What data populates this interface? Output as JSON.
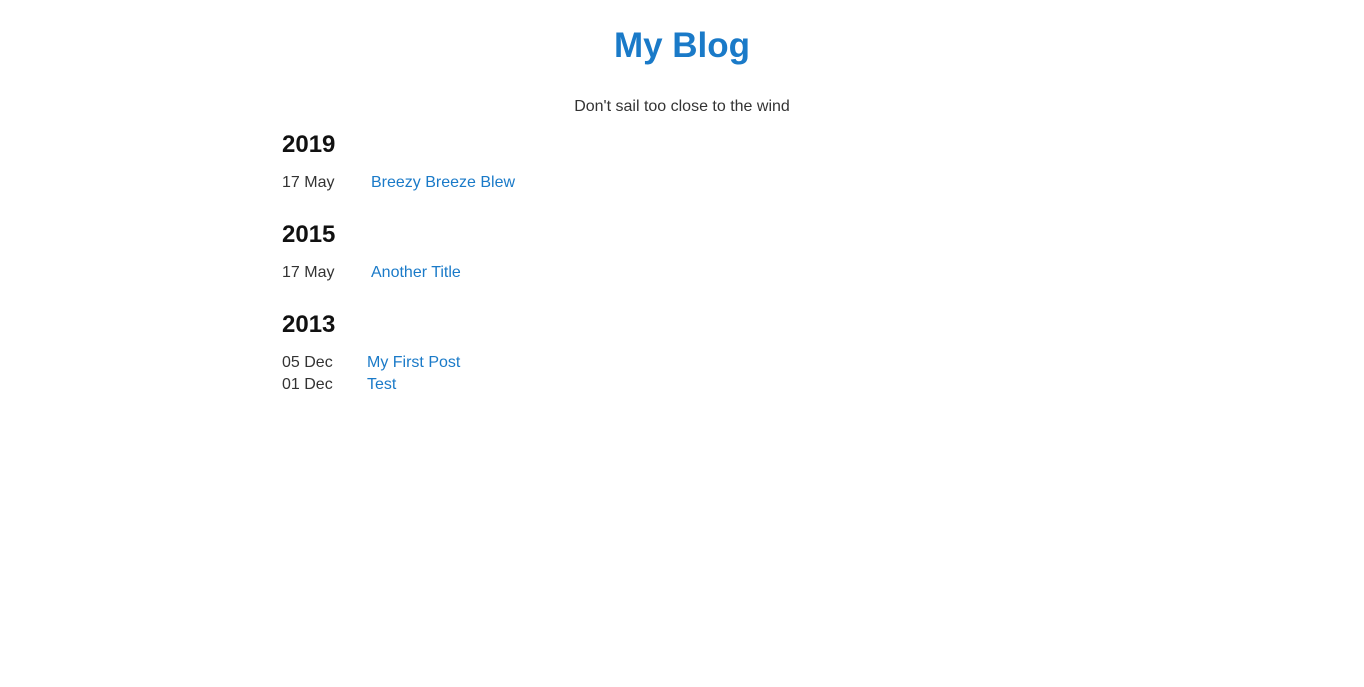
{
  "header": {
    "title": "My Blog",
    "tagline": "Don't sail too close to the wind"
  },
  "archive": {
    "years": [
      {
        "year": "2019",
        "posts": [
          {
            "date": "17 May",
            "title": "Breezy Breeze Blew"
          }
        ]
      },
      {
        "year": "2015",
        "posts": [
          {
            "date": "17 May",
            "title": "Another Title"
          }
        ]
      },
      {
        "year": "2013",
        "posts": [
          {
            "date": "05 Dec",
            "title": "My First Post"
          },
          {
            "date": "01 Dec",
            "title": "Test"
          }
        ]
      }
    ]
  },
  "colors": {
    "link": "#1a7ac8",
    "text": "#333333",
    "heading": "#111111",
    "background": "#ffffff"
  }
}
